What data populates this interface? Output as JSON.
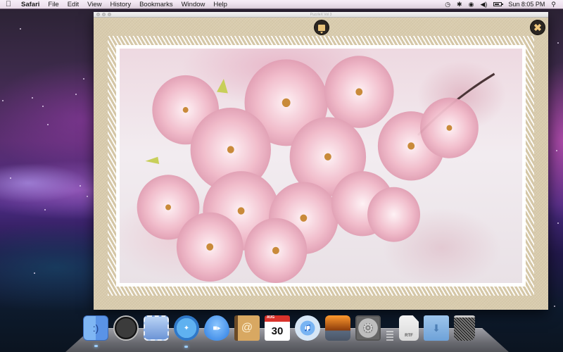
{
  "menubar": {
    "apple_icon": "apple-icon",
    "app_name": "Safari",
    "menus": [
      "File",
      "Edit",
      "View",
      "History",
      "Bookmarks",
      "Window",
      "Help"
    ],
    "status_icons": [
      "time-machine-icon",
      "bluetooth-icon",
      "wifi-icon",
      "volume-icon",
      "battery-icon"
    ],
    "clock": "Sun 8:05 PM",
    "spotlight_icon": "spotlight-icon"
  },
  "window": {
    "title": "PuzzleX Vol 3",
    "puzzle_button_icon": "picture-icon",
    "close_button_icon": "close-icon",
    "photo_subject": "Pink cherry blossoms"
  },
  "dock": {
    "apps": [
      {
        "name": "Finder",
        "icon": "finder-icon",
        "glyph": ":)",
        "running": true
      },
      {
        "name": "Dashboard",
        "icon": "dashboard-icon",
        "glyph": "",
        "running": false
      },
      {
        "name": "Mail",
        "icon": "mail-icon",
        "glyph": "",
        "running": false
      },
      {
        "name": "Safari",
        "icon": "safari-icon",
        "glyph": "✦",
        "running": true
      },
      {
        "name": "iChat",
        "icon": "ichat-icon",
        "glyph": "■▸",
        "running": false
      },
      {
        "name": "Address Book",
        "icon": "address-book-icon",
        "glyph": "@",
        "running": false
      },
      {
        "name": "iCal",
        "icon": "ical-icon",
        "glyph": "30",
        "month": "AUG",
        "running": false
      },
      {
        "name": "iTunes",
        "icon": "itunes-icon",
        "glyph": "♫",
        "running": false
      },
      {
        "name": "iPhoto",
        "icon": "iphoto-icon",
        "glyph": "",
        "running": false
      },
      {
        "name": "System Preferences",
        "icon": "system-preferences-icon",
        "glyph": "⚙",
        "running": false
      }
    ],
    "documents": [
      {
        "name": "RTF Document",
        "icon": "rtf-document-icon",
        "glyph": "RTF"
      },
      {
        "name": "Downloads",
        "icon": "downloads-folder-icon",
        "glyph": "⬇"
      },
      {
        "name": "Trash",
        "icon": "trash-icon",
        "glyph": ""
      }
    ]
  }
}
